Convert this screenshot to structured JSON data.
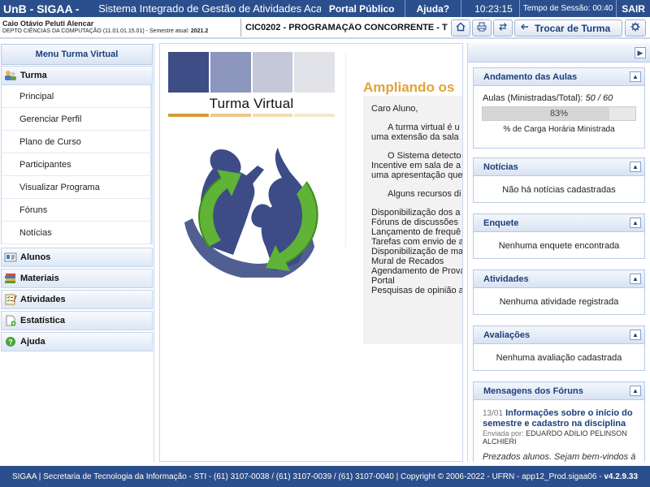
{
  "topbar": {
    "brand": "UnB - SIGAA -",
    "system_name": "Sistema Integrado de Gestão de Atividades Acadêmicas",
    "portal_publico": "Portal Público",
    "ajuda": "Ajuda?",
    "clock": "10:23:15",
    "session_label": "Tempo de Sessão: 00:40",
    "sair": "SAIR"
  },
  "user": {
    "name": "Caio Otávio Peluti Alencar",
    "dept": "DEPTO CIÊNCIAS DA COMPUTAÇÃO (11.01.01.15.01) - Semestre atual:",
    "semester": "2021.2"
  },
  "course": {
    "title": "CIC0202 - PROGRAMAÇÃO CONCORRENTE - T",
    "trocar_label": "Trocar de Turma"
  },
  "left_menu": {
    "header": "Menu Turma Virtual",
    "turma": "Turma",
    "turma_items": [
      "Principal",
      "Gerenciar Perfil",
      "Plano de Curso",
      "Participantes",
      "Visualizar Programa",
      "Fóruns",
      "Notícias"
    ],
    "sections": [
      "Alunos",
      "Materiais",
      "Atividades",
      "Estatística",
      "Ajuda"
    ]
  },
  "center": {
    "logo_title": "Turma Virtual",
    "heading": "Ampliando os",
    "greeting": "Caro Aluno,",
    "para1a": "A turma virtual é u",
    "para1b": "uma extensão da sala",
    "para2a": "O Sistema detecto",
    "para2b": "Incentive em sala de a",
    "para2c": "uma apresentação que",
    "para3": "Alguns recursos di",
    "list": [
      "Disponibilização dos a",
      "Fóruns de discussões",
      "Lançamento de frequê",
      "Tarefas com envio de a",
      "Disponibilização de ma",
      "Mural de Recados",
      "Agendamento de Prova",
      "Portal",
      "Pesquisas de opinião a"
    ]
  },
  "right": {
    "andamento": {
      "title": "Andamento das Aulas",
      "label": "Aulas (Ministradas/Total):",
      "value": "50 / 60",
      "percent_text": "83%",
      "percent": 83,
      "caption": "% de Carga Horária Ministrada"
    },
    "noticias": {
      "title": "Notícias",
      "body": "Não há notícias cadastradas"
    },
    "enquete": {
      "title": "Enquete",
      "body": "Nenhuma enquete encontrada"
    },
    "atividades": {
      "title": "Atividades",
      "body": "Nenhuma atividade registrada"
    },
    "avaliacoes": {
      "title": "Avaliações",
      "body": "Nenhuma avaliação cadastrada"
    },
    "mensagens": {
      "title": "Mensagens dos Fóruns",
      "date": "13/01",
      "topic": "Informações sobre o início do semestre e cadastro na disciplina",
      "sent_by_label": "Enviada por:",
      "sender": "EDUARDO ADILIO PELINSON ALCHIERI",
      "excerpt": "Prezados alunos. Sejam bem-vindos à"
    }
  },
  "footer": {
    "text": "SIGAA | Secretaria de Tecnologia da Informação - STI - (61) 3107-0038 / (61) 3107-0039 / (61) 3107-0040 | Copyright © 2006-2022 - UFRN - app12_Prod.sigaa06 -",
    "version": "v4.2.9.33"
  },
  "colors": {
    "brand_blue": "#2b4f8c",
    "accent_orange": "#e1a33b",
    "stripe_1": "#3e4d86",
    "stripe_2": "#8d96bc",
    "stripe_3": "#c4c8d8",
    "stripe_4": "#e2e3e8"
  }
}
